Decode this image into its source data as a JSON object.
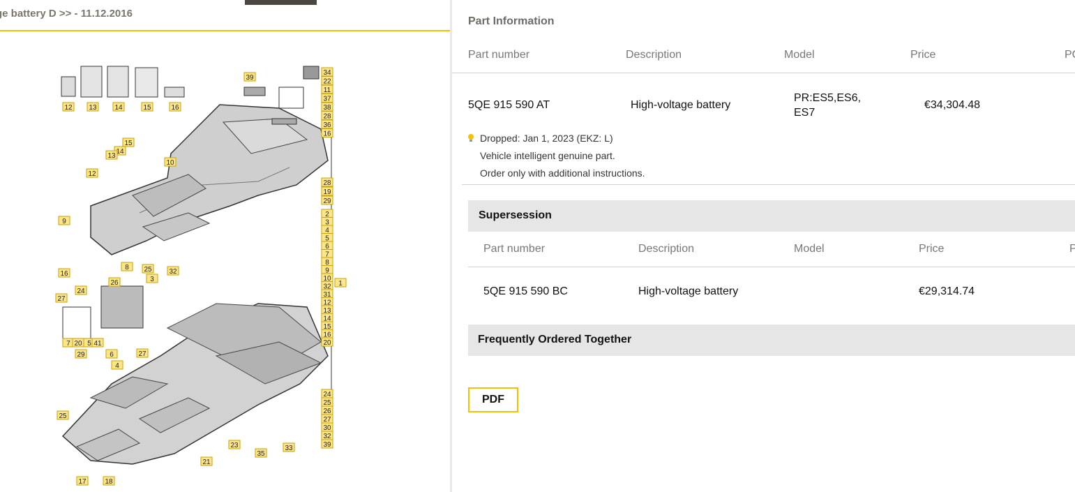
{
  "diagram": {
    "title": "ge battery D >> - 11.12.2016",
    "callouts": {
      "topleft": [
        "12",
        "13",
        "14",
        "15",
        "16"
      ],
      "right_column_top": [
        "34",
        "22",
        "11",
        "37",
        "38",
        "28",
        "36",
        "16"
      ],
      "right_column_mid": [
        "28",
        "19",
        "29"
      ],
      "right_column_long": [
        "2",
        "3",
        "4",
        "5",
        "6",
        "7",
        "8",
        "9",
        "10",
        "32",
        "31",
        "12",
        "13",
        "14",
        "15",
        "16",
        "20"
      ],
      "right_column_bottom": [
        "24",
        "25",
        "26",
        "27",
        "30",
        "32",
        "39"
      ],
      "misc": [
        "39",
        "15",
        "14",
        "13",
        "12",
        "10",
        "9",
        "16",
        "24",
        "26",
        "8",
        "25",
        "32",
        "3",
        "27",
        "7",
        "20",
        "5",
        "41",
        "29",
        "6",
        "4",
        "27",
        "25",
        "23",
        "21",
        "35",
        "33",
        "17",
        "18",
        "1"
      ]
    }
  },
  "part_info": {
    "title": "Part Information",
    "columns": [
      "Part number",
      "Description",
      "Model",
      "Price",
      "PC"
    ],
    "row": {
      "part_number": "5QE 915 590 AT",
      "description": "High-voltage battery",
      "model_line1": "PR:ES5,ES6,",
      "model_line2": "ES7",
      "price": "€34,304.48"
    },
    "notes": [
      "Dropped: Jan 1, 2023 (EKZ: L)",
      "Vehicle intelligent genuine part.",
      "Order only with additional instructions."
    ]
  },
  "supersession": {
    "title": "Supersession",
    "columns": [
      "Part number",
      "Description",
      "Model",
      "Price",
      "P"
    ],
    "row": {
      "part_number": "5QE 915 590 BC",
      "description": "High-voltage battery",
      "model": "",
      "price": "€29,314.74"
    }
  },
  "frequently_ordered": {
    "title": "Frequently Ordered Together"
  },
  "actions": {
    "pdf_label": "PDF"
  },
  "colors": {
    "accent": "#f2c200",
    "band": "#e6e6e6",
    "callout_fill": "#fde68a"
  },
  "icons": {
    "note": "lightbulb-icon"
  }
}
